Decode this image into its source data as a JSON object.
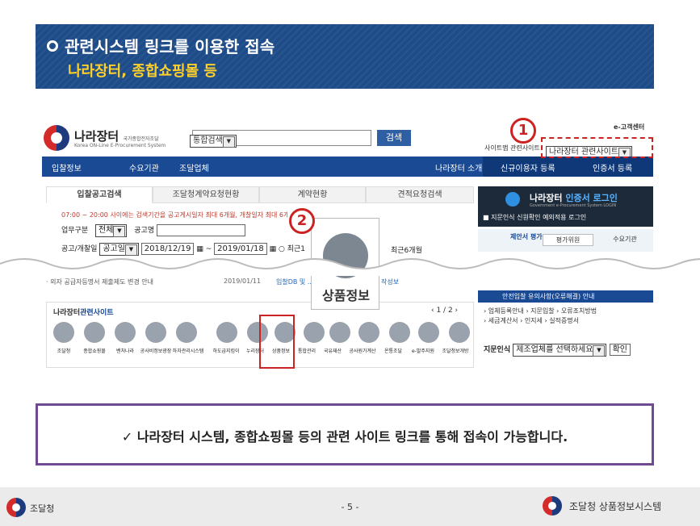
{
  "banner": {
    "line1": "관련시스템 링크를 이용한 접속",
    "line2": "나라장터, 종합쇼핑몰 등"
  },
  "screenshot": {
    "brand": "나라장터",
    "brand_small": "국가종합전자조달",
    "brand_sub": "Korea ON-Line E-Procurement System",
    "search_select": "통합검색",
    "search_button": "검색",
    "ecs": "e-고객센터",
    "top_links": "사이트맵  관련사이트",
    "related_select": "나라장터 관련사이트",
    "nav": [
      "입찰정보",
      "수요기관",
      "조달업체",
      "나라장터 소개",
      "신규이용자 등록",
      "인증서 등록"
    ],
    "tabs": [
      "입찰공고검색",
      "조달청계약요청현황",
      "계약현황",
      "견적요청검색"
    ],
    "notice": "07:00 ~ 20:00 사이에는 검색기간을 공고게시일자 최대 6개월, 개찰일자 최대 6개월까지 검색 가능합니다 (토,일요일 및 공휴일 제외)",
    "row1_label": "업무구분",
    "row1_value": "전체",
    "row1_label2": "공고명",
    "row2_label": "공고/개찰일",
    "row2_select": "공고일",
    "date_from": "2018/12/19",
    "date_to": "2019/01/18",
    "row2_recent": "○ 최근1",
    "row2_recent6": "최근6개월",
    "news": "· 외자 공급자등명서 제출제도 변경 안내",
    "news_date": "2019/01/11",
    "news2": "입찰DB 및 ...",
    "news3": "작성보",
    "related_title_a": "나라장터",
    "related_title_b": "관련사이트",
    "pager": "1 / 2",
    "icon_labels": [
      "조달청",
      "종합쇼핑몰",
      "벤처나라",
      "공사비정보광장",
      "하자관리시스템",
      "하도급지킴이",
      "누리장터",
      "상품정보",
      "통합관리",
      "국유재산",
      "공사원가계산",
      "온통조달",
      "e-발주지원",
      "조달청보개방"
    ],
    "zoom_label": "상품정보",
    "num1": "1",
    "num2": "2",
    "cert_title_a": "나라장터",
    "cert_title_b": "인증서 로그인",
    "cert_sub": "Government e-Procurement System LOGIN",
    "cert_note": "■ 지문인식 신원확인 예외적용 로그인",
    "prop_a": "제안서 평가",
    "prop_b": "평가위원",
    "prop_c": "수요기관",
    "bid_bar": "안전입찰 유의사항(오류해결) 안내",
    "links_line1": "› 업체등록안내  › 지문입찰  › 오류조치방법",
    "links_line2": "› 세금계산서  › 인지세  › 실적증명서",
    "jimun_label": "지문인식",
    "jimun_select": "제조업체를 선택하세요",
    "jimun_btn": "확인"
  },
  "note": "✓ 나라장터 시스템, 종합쇼핑몰 등의 관련 사이트 링크를 통해 접속이 가능합니다.",
  "footer": {
    "left": "조달청",
    "page": "- 5 -",
    "right": "조달청 상품정보시스템"
  }
}
